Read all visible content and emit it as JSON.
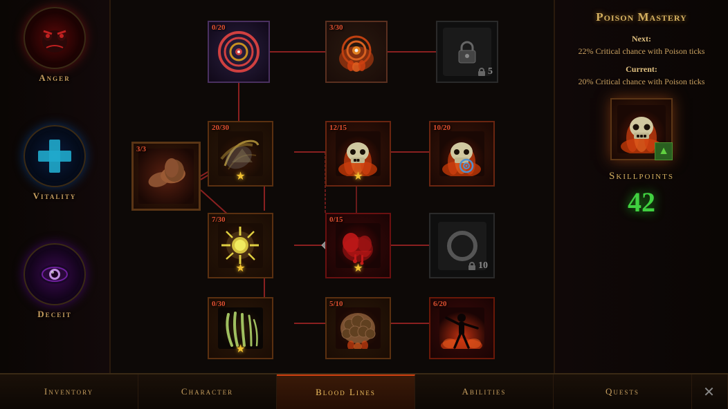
{
  "title": "Blood Lines",
  "stats": [
    {
      "id": "anger",
      "label": "Anger",
      "emoji": "👿",
      "colorClass": "anger"
    },
    {
      "id": "vitality",
      "label": "Vitality",
      "emoji": "➕",
      "colorClass": "vitality"
    },
    {
      "id": "deceit",
      "label": "Deceit",
      "emoji": "👁",
      "colorClass": "deceit"
    }
  ],
  "armNode": {
    "count": "3/3"
  },
  "skillNodes": [
    {
      "id": "n1",
      "count": "0/20",
      "hasStar": false,
      "locked": false,
      "type": "target",
      "col": 1,
      "row": 0
    },
    {
      "id": "n2",
      "count": "3/30",
      "hasStar": false,
      "locked": false,
      "type": "target2",
      "col": 2,
      "row": 0
    },
    {
      "id": "n3",
      "count": "",
      "hasStar": false,
      "locked": true,
      "lockNum": "5",
      "type": "lock",
      "col": 3,
      "row": 0
    },
    {
      "id": "n4",
      "count": "20/30",
      "hasStar": true,
      "locked": false,
      "type": "wind",
      "col": 1,
      "row": 1
    },
    {
      "id": "n5",
      "count": "12/15",
      "hasStar": true,
      "locked": false,
      "type": "skull-fire",
      "col": 2,
      "row": 1
    },
    {
      "id": "n6",
      "count": "10/20",
      "hasStar": false,
      "locked": false,
      "type": "skull-ring",
      "col": 3,
      "row": 1
    },
    {
      "id": "n7",
      "count": "7/30",
      "hasStar": true,
      "locked": false,
      "type": "star-burst",
      "col": 1,
      "row": 2
    },
    {
      "id": "n8",
      "count": "0/15",
      "hasStar": true,
      "locked": false,
      "type": "blood",
      "col": 2,
      "row": 2
    },
    {
      "id": "n9",
      "count": "",
      "hasStar": false,
      "locked": true,
      "lockNum": "10",
      "type": "lock-ring",
      "col": 3,
      "row": 2
    },
    {
      "id": "n10",
      "count": "0/30",
      "hasStar": true,
      "locked": false,
      "type": "claw",
      "col": 1,
      "row": 3
    },
    {
      "id": "n11",
      "count": "5/10",
      "hasStar": false,
      "locked": false,
      "type": "armor",
      "col": 2,
      "row": 3
    },
    {
      "id": "n12",
      "count": "6/20",
      "hasStar": false,
      "locked": false,
      "type": "silhouette",
      "col": 3,
      "row": 3
    }
  ],
  "infoPanel": {
    "title": "Poison Mastery",
    "nextLabel": "Next:",
    "nextDesc": "22% Critical chance with Poison ticks",
    "currentLabel": "Current:",
    "currentDesc": "20% Critical chance with Poison ticks",
    "skillIcon": "💀",
    "skillpointsLabel": "Skillpoints",
    "skillpointsValue": "42"
  },
  "navButtons": [
    {
      "id": "inventory",
      "label": "Inventory",
      "active": false
    },
    {
      "id": "character",
      "label": "Character",
      "active": false
    },
    {
      "id": "bloodlines",
      "label": "Blood Lines",
      "active": true
    },
    {
      "id": "abilities",
      "label": "Abilities",
      "active": false
    },
    {
      "id": "quests",
      "label": "Quests",
      "active": false
    }
  ]
}
